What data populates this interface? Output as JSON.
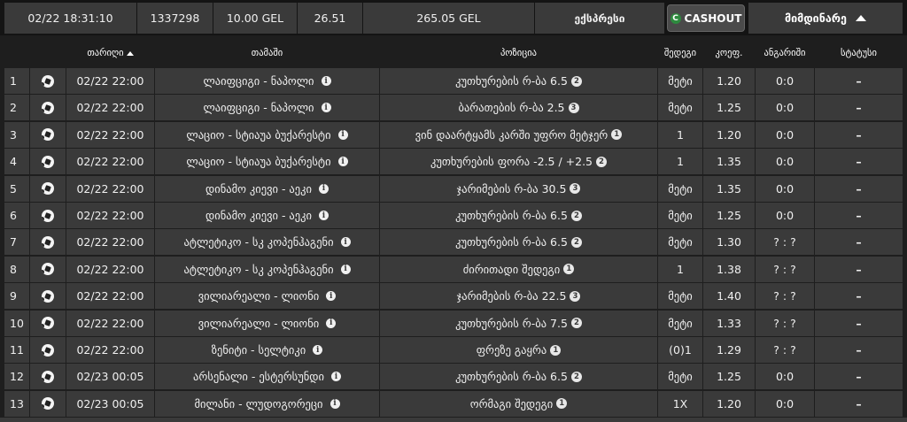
{
  "topbar": {
    "datetime": "02/22 18:31:10",
    "ticket_id": "1337298",
    "stake": "10.00 GEL",
    "total_odds": "26.51",
    "payout": "265.05 GEL",
    "express_label": "ექსპრესი",
    "cashout_label": "CASHOUT",
    "current_label": "მიმდინარე"
  },
  "columns": {
    "date": "თარიღი",
    "game": "თამაში",
    "position": "პოზიცია",
    "result": "შედეგი",
    "odds": "კოეფ.",
    "calc": "ანგარიში",
    "status": "სტატუსი"
  },
  "rows": [
    {
      "n": "1",
      "date": "02/22 22:00",
      "game": "ლაიფციგი - ნაპოლი",
      "pos": "კუთხურების რ-ბა 6.5",
      "pos_mark": "2",
      "res": "მეტი",
      "odds": "1.20",
      "calc": "0:0",
      "status": "–"
    },
    {
      "n": "2",
      "date": "02/22 22:00",
      "game": "ლაიფციგი - ნაპოლი",
      "pos": "ბარათების რ-ბა 2.5",
      "pos_mark": "3",
      "res": "მეტი",
      "odds": "1.25",
      "calc": "0:0",
      "status": "–"
    },
    {
      "n": "3",
      "date": "02/22 22:00",
      "game": "ლაციო - სტიაუა ბუქარესტი",
      "pos": "ვინ დაარტყამს კარში უფრო მეტჯერ",
      "pos_mark": "1",
      "res": "1",
      "odds": "1.20",
      "calc": "0:0",
      "status": "–"
    },
    {
      "n": "4",
      "date": "02/22 22:00",
      "game": "ლაციო - სტიაუა ბუქარესტი",
      "pos": "კუთხურების ფორა -2.5 / +2.5",
      "pos_mark": "2",
      "res": "1",
      "odds": "1.35",
      "calc": "0:0",
      "status": "–"
    },
    {
      "n": "5",
      "date": "02/22 22:00",
      "game": "დინამო კიევი - აეკი",
      "pos": "ჯარიმების რ-ბა 30.5",
      "pos_mark": "3",
      "res": "მეტი",
      "odds": "1.35",
      "calc": "0:0",
      "status": "–"
    },
    {
      "n": "6",
      "date": "02/22 22:00",
      "game": "დინამო კიევი - აეკი",
      "pos": "კუთხურების რ-ბა 6.5",
      "pos_mark": "2",
      "res": "მეტი",
      "odds": "1.25",
      "calc": "0:0",
      "status": "–"
    },
    {
      "n": "7",
      "date": "02/22 22:00",
      "game": "ატლეტიკო - სკ კოპენჰაგენი",
      "pos": "კუთხურების რ-ბა 6.5",
      "pos_mark": "2",
      "res": "მეტი",
      "odds": "1.30",
      "calc": "? : ?",
      "status": "–"
    },
    {
      "n": "8",
      "date": "02/22 22:00",
      "game": "ატლეტიკო - სკ კოპენჰაგენი",
      "pos": "ძირითადი შედეგი",
      "pos_mark": "1",
      "res": "1",
      "odds": "1.38",
      "calc": "? : ?",
      "status": "–"
    },
    {
      "n": "9",
      "date": "02/22 22:00",
      "game": "ვილიარეალი - ლიონი",
      "pos": "ჯარიმების რ-ბა 22.5",
      "pos_mark": "3",
      "res": "მეტი",
      "odds": "1.40",
      "calc": "? : ?",
      "status": "–"
    },
    {
      "n": "10",
      "date": "02/22 22:00",
      "game": "ვილიარეალი - ლიონი",
      "pos": "კუთხურების რ-ბა 7.5",
      "pos_mark": "2",
      "res": "მეტი",
      "odds": "1.33",
      "calc": "? : ?",
      "status": "–"
    },
    {
      "n": "11",
      "date": "02/22 22:00",
      "game": "ზენიტი - სელტიკი",
      "pos": "ფრეზე გაყრა",
      "pos_mark": "1",
      "res": "(0)1",
      "odds": "1.29",
      "calc": "? : ?",
      "status": "–"
    },
    {
      "n": "12",
      "date": "02/23 00:05",
      "game": "არსენალი - ესტერსუნდი",
      "pos": "კუთხურების რ-ბა 6.5",
      "pos_mark": "2",
      "res": "მეტი",
      "odds": "1.25",
      "calc": "0:0",
      "status": "–"
    },
    {
      "n": "13",
      "date": "02/23 00:05",
      "game": "მილანი - ლუდოგორეცი",
      "pos": "ორმაგი შედეგი",
      "pos_mark": "1",
      "res": "1X",
      "odds": "1.20",
      "calc": "0:0",
      "status": "–"
    }
  ]
}
